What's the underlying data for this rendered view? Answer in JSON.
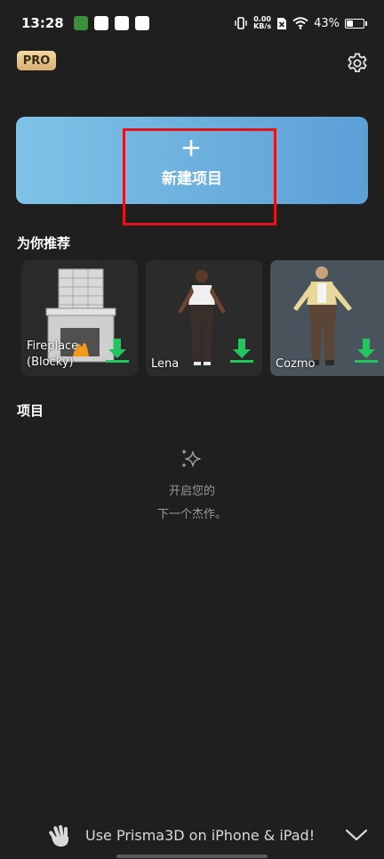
{
  "status_bar": {
    "time": "13:28",
    "net_speed_value": "0.00",
    "net_speed_unit": "KB/s",
    "battery_percent": "43%",
    "battery_level": 0.43
  },
  "header": {
    "pro_label": "PRO",
    "settings_icon": "gear-icon"
  },
  "new_project": {
    "plus_icon": "plus-icon",
    "label": "新建项目"
  },
  "recommended": {
    "title": "为你推荐",
    "items": [
      {
        "name_line1": "Fireplace",
        "name_line2": "(Blocky)",
        "icon": "download-icon"
      },
      {
        "name_line1": "Lena",
        "icon": "download-icon"
      },
      {
        "name_line1": "Cozmo",
        "icon": "download-icon"
      }
    ]
  },
  "projects": {
    "title": "项目",
    "empty_icon": "sparkle-icon",
    "empty_line1": "开启您的",
    "empty_line2": "下一个杰作。"
  },
  "banner": {
    "icon": "wave-icon",
    "text": "Use Prisma3D on iPhone & iPad!",
    "collapse_icon": "chevron-down-icon"
  },
  "colors": {
    "background": "#1f1f1f",
    "accent_blue": "#5c9fd8",
    "download_green": "#22c55e",
    "highlight_red": "#e0141c"
  }
}
